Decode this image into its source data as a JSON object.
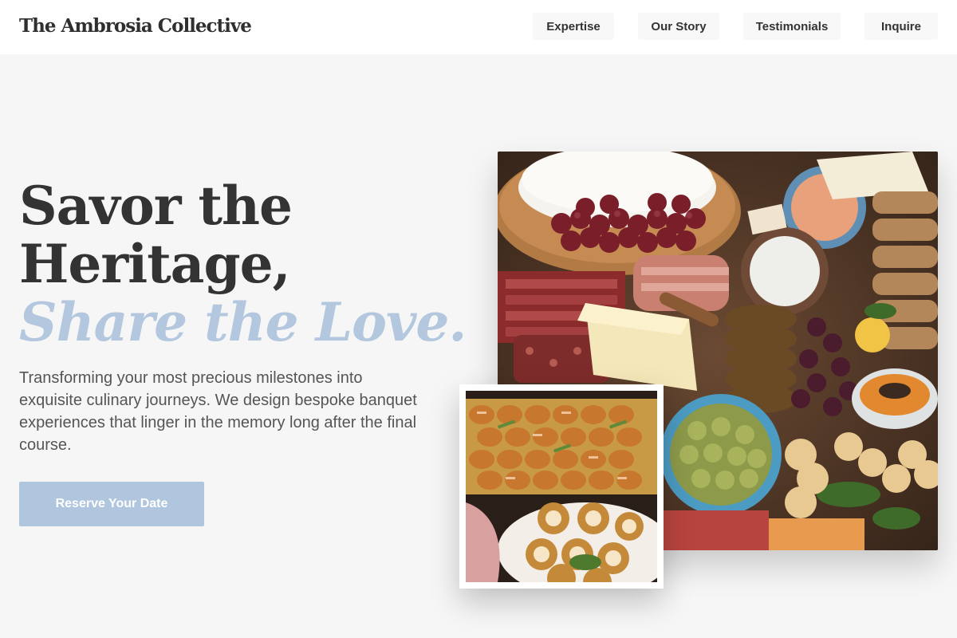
{
  "header": {
    "brand": "The Ambrosia Collective",
    "nav": [
      {
        "label": "Expertise"
      },
      {
        "label": "Our Story"
      },
      {
        "label": "Testimonials"
      },
      {
        "label": "Inquire"
      }
    ]
  },
  "hero": {
    "headline_line1": "Savor the",
    "headline_line2": "Heritage,",
    "headline_accent": "Share the Love.",
    "lead": "Transforming your most precious milestones into exquisite culinary journeys. We design bespoke banquet experiences that linger in the memory long after the final course.",
    "cta_label": "Reserve Your Date"
  },
  "images": {
    "main": "charcuterie-board-photo",
    "inset": "pastries-platter-photo"
  },
  "colors": {
    "accent": "#b3c7df",
    "button": "#b0c6df",
    "background": "#f6f6f6",
    "header": "#ffffff"
  }
}
